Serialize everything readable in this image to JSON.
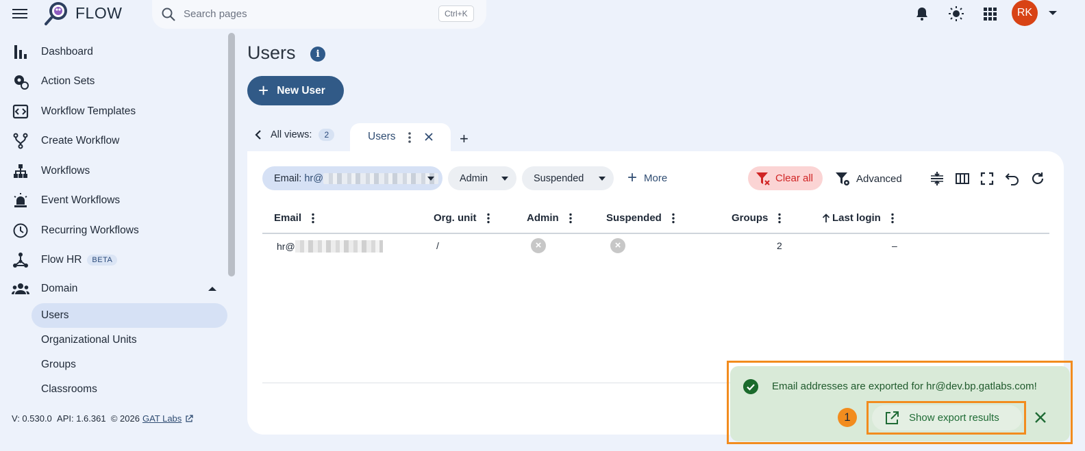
{
  "app": {
    "brand": "FLOW"
  },
  "search": {
    "placeholder": "Search pages",
    "shortcut": "Ctrl+K"
  },
  "user": {
    "initials": "RK",
    "avatar_color": "#d84315"
  },
  "sidebar": {
    "items": [
      {
        "label": "Dashboard",
        "icon": "bar-chart-icon"
      },
      {
        "label": "Action Sets",
        "icon": "gear-refresh-icon"
      },
      {
        "label": "Workflow Templates",
        "icon": "template-code-icon"
      },
      {
        "label": "Create Workflow",
        "icon": "branch-icon"
      },
      {
        "label": "Workflows",
        "icon": "hierarchy-icon"
      },
      {
        "label": "Event Workflows",
        "icon": "alarm-light-icon"
      },
      {
        "label": "Recurring Workflows",
        "icon": "clock-icon"
      },
      {
        "label": "Flow HR",
        "icon": "hr-network-icon",
        "badge": "BETA"
      },
      {
        "label": "Domain",
        "icon": "group-icon"
      }
    ],
    "sub_items": [
      {
        "label": "Users",
        "active": true
      },
      {
        "label": "Organizational Units",
        "active": false
      },
      {
        "label": "Groups",
        "active": false
      },
      {
        "label": "Classrooms",
        "active": false
      }
    ],
    "footer": {
      "version": "V: 0.530.0",
      "api": "API: 1.6.361",
      "copyright": "© 2026",
      "link": "GAT Labs"
    }
  },
  "main": {
    "title": "Users",
    "new_user_label": "New User",
    "views": {
      "label": "All views:",
      "count": "2"
    },
    "tab": {
      "label": "Users"
    },
    "filters": {
      "email_prefix": "Email:",
      "email_value": "hr@",
      "admin": "Admin",
      "suspended": "Suspended",
      "more": "More",
      "clear_all": "Clear all",
      "advanced": "Advanced"
    },
    "columns": [
      "Email",
      "Org. unit",
      "Admin",
      "Suspended",
      "Groups",
      "Last login"
    ],
    "rows": [
      {
        "email": "hr@",
        "org_unit": "/",
        "admin": false,
        "suspended": false,
        "groups": "2",
        "last_login": "–"
      }
    ]
  },
  "toast": {
    "message": "Email addresses are exported for hr@dev.bp.gatlabs.com!",
    "action_label": "Show export results",
    "step_number": "1"
  },
  "colors": {
    "primary": "#315a87",
    "danger": "#d02424",
    "success": "#1b6b2c",
    "highlight": "#f28c1e"
  }
}
